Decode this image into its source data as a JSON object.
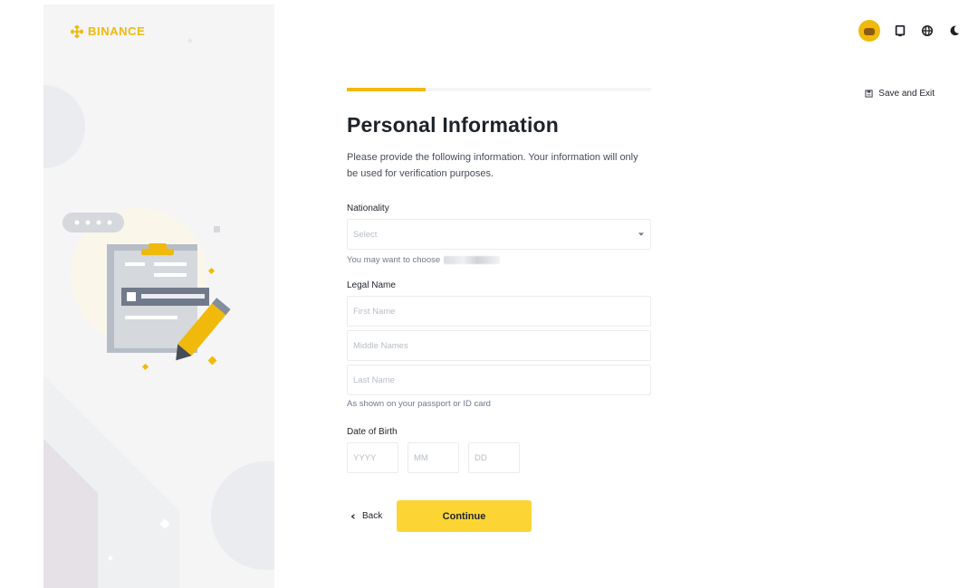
{
  "brand": {
    "logo_text": "BINANCE",
    "accent_color": "#f0b90b",
    "button_color": "#fcd535"
  },
  "header": {
    "icons": [
      "avatar",
      "bookmark-icon",
      "globe-icon",
      "moon-icon"
    ],
    "save_exit_label": "Save and Exit"
  },
  "progress": {
    "fraction": 0.26
  },
  "form": {
    "title": "Personal Information",
    "subtitle": "Please provide the following information. Your information will only be used for verification purposes.",
    "nationality": {
      "label": "Nationality",
      "placeholder": "Select",
      "helper": "You may want to choose"
    },
    "legal_name": {
      "label": "Legal Name",
      "first_placeholder": "First Name",
      "middle_placeholder": "Middle Names",
      "last_placeholder": "Last Name",
      "helper": "As shown on your passport or ID card"
    },
    "dob": {
      "label": "Date of Birth",
      "year_placeholder": "YYYY",
      "month_placeholder": "MM",
      "day_placeholder": "DD"
    }
  },
  "actions": {
    "back_label": "Back",
    "continue_label": "Continue"
  }
}
